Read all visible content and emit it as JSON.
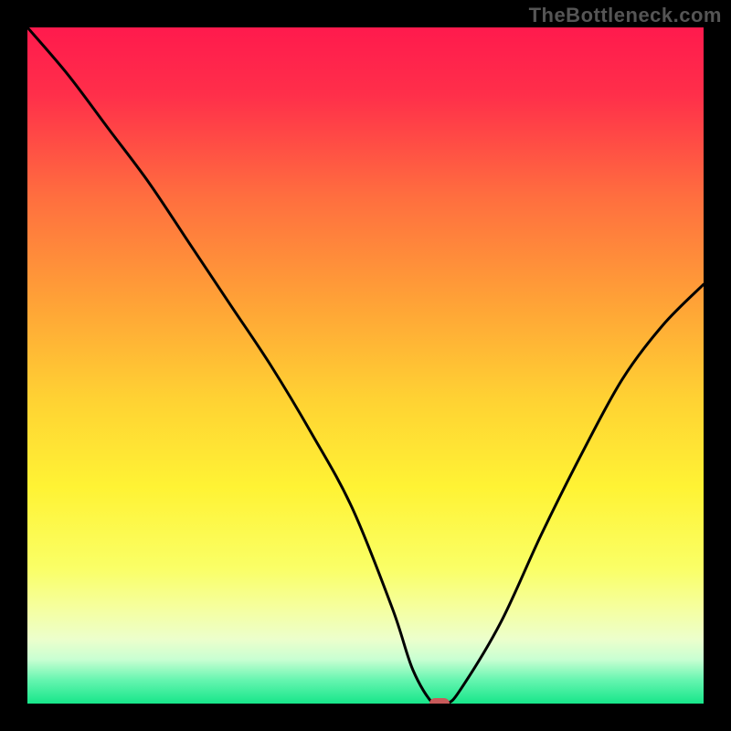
{
  "watermark": "TheBottleneck.com",
  "colors": {
    "frame": "#000000",
    "marker": "#c85a5a",
    "curve": "#000000",
    "watermark": "#555555"
  },
  "chart_data": {
    "type": "line",
    "title": "",
    "xlabel": "",
    "ylabel": "",
    "xlim": [
      0,
      100
    ],
    "ylim": [
      0,
      100
    ],
    "grid": false,
    "series": [
      {
        "name": "bottleneck-curve",
        "x": [
          0,
          6,
          12,
          18,
          24,
          30,
          36,
          42,
          48,
          54,
          57,
          60,
          62,
          64,
          70,
          76,
          82,
          88,
          94,
          100
        ],
        "y": [
          100,
          93,
          85,
          77,
          68,
          59,
          50,
          40,
          29,
          14,
          5,
          0,
          0,
          2,
          12,
          25,
          37,
          48,
          56,
          62
        ]
      }
    ],
    "annotations": [
      {
        "name": "optimal-marker",
        "x": 61,
        "y": 0
      }
    ],
    "background_gradient": {
      "stops": [
        {
          "offset": 0.0,
          "color": "#ff1a4d"
        },
        {
          "offset": 0.1,
          "color": "#ff2f4a"
        },
        {
          "offset": 0.25,
          "color": "#ff6e3f"
        },
        {
          "offset": 0.4,
          "color": "#ffa037"
        },
        {
          "offset": 0.55,
          "color": "#ffd233"
        },
        {
          "offset": 0.68,
          "color": "#fff334"
        },
        {
          "offset": 0.8,
          "color": "#faff66"
        },
        {
          "offset": 0.86,
          "color": "#f5ffa0"
        },
        {
          "offset": 0.905,
          "color": "#ecffcc"
        },
        {
          "offset": 0.935,
          "color": "#c8ffd2"
        },
        {
          "offset": 0.965,
          "color": "#66f5b0"
        },
        {
          "offset": 1.0,
          "color": "#17e68a"
        }
      ]
    }
  }
}
